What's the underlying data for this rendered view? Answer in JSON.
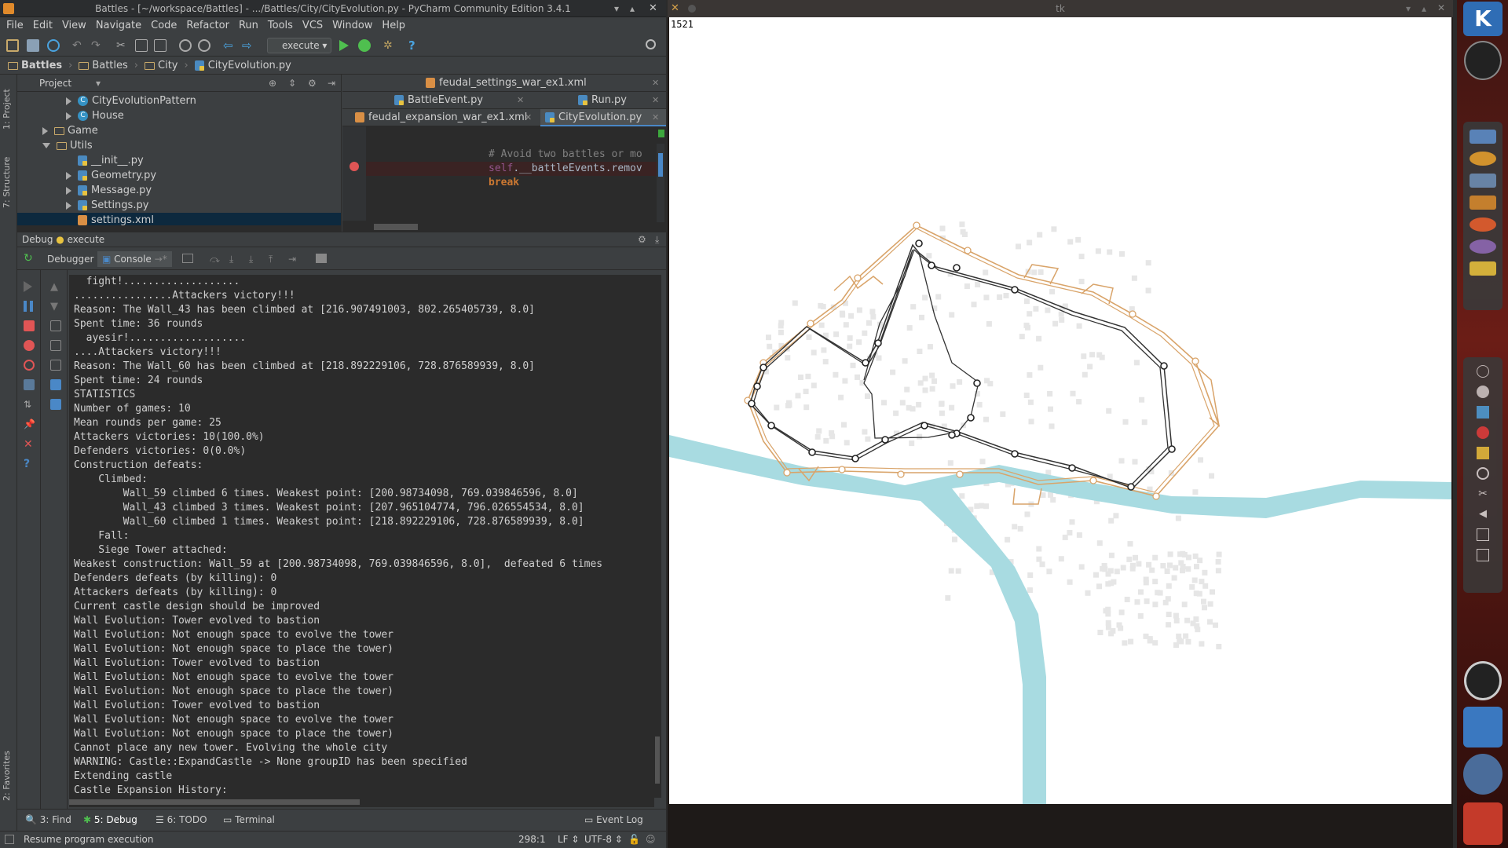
{
  "ide": {
    "window_title": "Battles - [~/workspace/Battles] - .../Battles/City/CityEvolution.py - PyCharm Community Edition 3.4.1",
    "menu": [
      "File",
      "Edit",
      "View",
      "Navigate",
      "Code",
      "Refactor",
      "Run",
      "Tools",
      "VCS",
      "Window",
      "Help"
    ],
    "run_config": "execute",
    "breadcrumbs": [
      "Battles",
      "Battles",
      "City",
      "CityEvolution.py"
    ],
    "project_header": "Project",
    "tree": [
      {
        "label": "CityEvolutionPattern",
        "kind": "class",
        "indent": 2,
        "arrow": "right"
      },
      {
        "label": "House",
        "kind": "class",
        "indent": 2,
        "arrow": "right"
      },
      {
        "label": "Game",
        "kind": "folder",
        "indent": 1,
        "arrow": "right"
      },
      {
        "label": "Utils",
        "kind": "folder",
        "indent": 1,
        "arrow": "down"
      },
      {
        "label": "__init__.py",
        "kind": "py",
        "indent": 2,
        "arrow": ""
      },
      {
        "label": "Geometry.py",
        "kind": "py",
        "indent": 2,
        "arrow": "right"
      },
      {
        "label": "Message.py",
        "kind": "py",
        "indent": 2,
        "arrow": "right"
      },
      {
        "label": "Settings.py",
        "kind": "py",
        "indent": 2,
        "arrow": "right"
      },
      {
        "label": "settings.xml",
        "kind": "xml",
        "indent": 2,
        "arrow": ""
      }
    ],
    "editor_tabs": {
      "row1": [
        "feudal_settings_war_ex1.xml"
      ],
      "row2": [
        "BattleEvent.py",
        "Run.py"
      ],
      "row3": [
        "feudal_expansion_war_ex1.xml",
        "CityEvolution.py"
      ]
    },
    "code": {
      "comment": "# Avoid two battles or mo",
      "self": "self",
      "rest": ".__battleEvents.remov",
      "kw": "break"
    },
    "debug_title": "Debug",
    "debug_config": "execute",
    "debug_tabs": [
      "Debugger",
      "Console"
    ],
    "console_lines": [
      "  fight!...................",
      "................Attackers victory!!!",
      "Reason: The Wall_43 has been climbed at [216.907491003, 802.265405739, 8.0]",
      "Spent time: 36 rounds",
      "  ayesir!...................",
      "....Attackers victory!!!",
      "Reason: The Wall_60 has been climbed at [218.892229106, 728.876589939, 8.0]",
      "Spent time: 24 rounds",
      "STATISTICS",
      "Number of games: 10",
      "Mean rounds per game: 25",
      "Attackers victories: 10(100.0%)",
      "Defenders victories: 0(0.0%)",
      "Construction defeats:",
      "    Climbed:",
      "        Wall_59 climbed 6 times. Weakest point: [200.98734098, 769.039846596, 8.0]",
      "        Wall_43 climbed 3 times. Weakest point: [207.965104774, 796.026554534, 8.0]",
      "        Wall_60 climbed 1 times. Weakest point: [218.892229106, 728.876589939, 8.0]",
      "    Fall:",
      "    Siege Tower attached:",
      "Weakest construction: Wall_59 at [200.98734098, 769.039846596, 8.0],  defeated 6 times",
      "Defenders defeats (by killing): 0",
      "Attackers defeats (by killing): 0",
      "Current castle design should be improved",
      "Wall Evolution: Tower evolved to bastion",
      "Wall Evolution: Not enough space to evolve the tower",
      "Wall Evolution: Not enough space to place the tower)",
      "Wall Evolution: Tower evolved to bastion",
      "Wall Evolution: Not enough space to evolve the tower",
      "Wall Evolution: Not enough space to place the tower)",
      "Wall Evolution: Tower evolved to bastion",
      "Wall Evolution: Not enough space to evolve the tower",
      "Wall Evolution: Not enough space to place the tower)",
      "Cannot place any new tower. Evolving the whole city",
      "WARNING: Castle::ExpandCastle -> None groupID has been specified",
      "Extending castle",
      "Castle Expansion History:"
    ],
    "bottom_tabs": [
      "3: Find",
      "5: Debug",
      "6: TODO",
      "Terminal",
      "Event Log"
    ],
    "status": {
      "message": "Resume program execution",
      "position": "298:1",
      "line_sep": "LF",
      "encoding": "UTF-8"
    },
    "left_tabs": [
      "1: Project",
      "7: Structure",
      "2: Favorites"
    ]
  },
  "tk": {
    "title": "tk",
    "counter": "1521"
  },
  "colors": {
    "river": "#a8dbe1",
    "outer_wall": "#d9a46a",
    "inner_wall": "#333333",
    "house": "#e6e6e6"
  }
}
